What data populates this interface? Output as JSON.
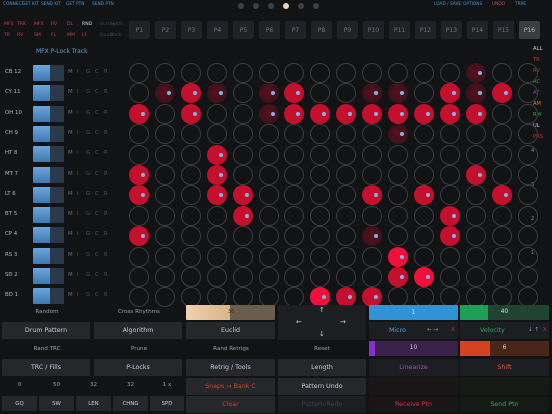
{
  "top_links_left": [
    "CONNECT",
    "GET KIT",
    "SEND KIT",
    "GET PTN",
    "SEND PTN"
  ],
  "top_links_right": [
    "LOAD / SAVE",
    "OPTIONS",
    "UNDO",
    "TRPE"
  ],
  "page_dots": [
    false,
    false,
    false,
    true,
    false,
    false
  ],
  "fx_row1": [
    "MFX",
    "TRK",
    "MFX",
    "RV",
    "DL",
    "RND",
    "Buttons",
    "Synth"
  ],
  "fx_row2": [
    "TR",
    "RV",
    "SM",
    "FL",
    "MM",
    "LF",
    "Quant",
    "Back"
  ],
  "track_title": "MFX P-Lock Track",
  "pattern_tabs": [
    "P1",
    "P2",
    "P3",
    "P4",
    "P5",
    "P6",
    "P7",
    "P8",
    "P9",
    "P10",
    "P11",
    "P12",
    "P13",
    "P14",
    "P15",
    "P16"
  ],
  "selected_tab": 15,
  "right_filters": [
    "ALL",
    "TR",
    "RV",
    "AC",
    "AF",
    "AM",
    "RM",
    "UL",
    "PRS"
  ],
  "right_nums": [
    "4",
    "3",
    "2",
    "1"
  ],
  "tracks": [
    {
      "label": "CB 12",
      "fill": 0.55
    },
    {
      "label": "CY 11",
      "fill": 0.55
    },
    {
      "label": "OH 10",
      "fill": 0.55
    },
    {
      "label": "CH 9",
      "fill": 0.55
    },
    {
      "label": "HT 8",
      "fill": 0.55
    },
    {
      "label": "MT 7",
      "fill": 0.55
    },
    {
      "label": "LT 6",
      "fill": 0.55
    },
    {
      "label": "BT 5",
      "fill": 0.55
    },
    {
      "label": "CP 4",
      "fill": 0.55
    },
    {
      "label": "RS 3",
      "fill": 0.55
    },
    {
      "label": "SD 2",
      "fill": 0.55
    },
    {
      "label": "BD 1",
      "fill": 0.55
    }
  ],
  "row_icons": [
    "M",
    "I",
    "G",
    "C",
    "R"
  ],
  "grid": [
    ".............d..",
    ".dod.do..dd.odo.",
    "o.o..doooooooo..",
    "..........d.....",
    "...o............",
    "o..o.........o..",
    "o..oo....o.o..o.",
    "....o.......o...",
    "o........d..o...",
    "..........h.....",
    "..........oh....",
    ".......hoo......"
  ],
  "bottom": {
    "random": "Random",
    "cross_rhythms": "Cross Rhythms",
    "slider_value": "36",
    "drum_pattern": "Drum Pattern",
    "algorithm": "Algorithm",
    "euclid": "Euclid",
    "rand_trc": "Rand TRC",
    "prune": "Prune",
    "rand_retrigs": "Rand Retrigs",
    "reset": "Reset",
    "trc_fills": "TRC / Fills",
    "p_locks": "P-Locks",
    "retrig_tools": "Retrig / Tools",
    "length": "Length",
    "pattern_undo": "Pattern Undo",
    "snaps_bank": "Snaps → Bank C",
    "clear": "Clear",
    "pattern_redo": "Pattern Redo",
    "nums": [
      "0",
      "50",
      "32",
      "32",
      "1 x"
    ],
    "gq": [
      "GQ",
      "SW",
      "LEN",
      "CHNG",
      "SPD"
    ],
    "arrows": [
      "↑",
      "←",
      "→",
      "↓"
    ],
    "micro_val": "1",
    "micro": "Micro",
    "micro_arrows": "← →",
    "micro_x": "X",
    "velocity_val": "40",
    "velocity": "Velocity",
    "vel_arrows": "↓ ↑",
    "vel_x": "X",
    "linearize_val": "10",
    "linearize": "Linearize",
    "shift_val": "6",
    "shift": "Shift",
    "receive": "Receive Ptn",
    "send": "Send Ptn"
  },
  "colors": {
    "accent_red": "#c40f2d",
    "hot_red": "#f2103a",
    "link_blue": "#3f9edb",
    "velocity_green": "#1e9e57",
    "linearize_purple": "#8b2fc9",
    "shift_orange": "#d4421f",
    "micro_blue": "#2f93d6"
  }
}
